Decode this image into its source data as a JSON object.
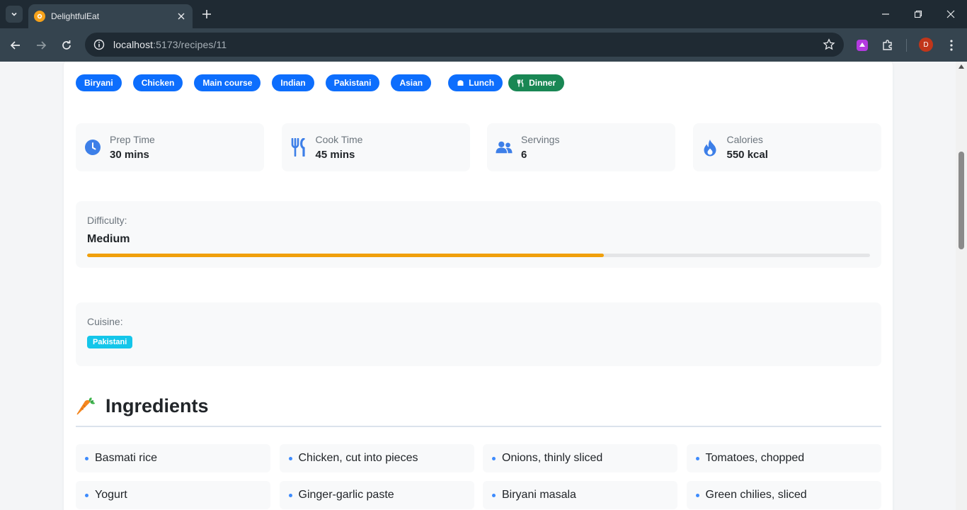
{
  "browser": {
    "tab_title": "DelightfulEat",
    "url_host": "localhost",
    "url_rest": ":5173/recipes/11",
    "profile_initial": "D"
  },
  "tags": [
    {
      "label": "Biryani"
    },
    {
      "label": "Chicken"
    },
    {
      "label": "Main course"
    },
    {
      "label": "Indian"
    },
    {
      "label": "Pakistani"
    },
    {
      "label": "Asian"
    }
  ],
  "meals": [
    {
      "label": "Lunch",
      "icon": "hat-icon",
      "color": "#0d6efd"
    },
    {
      "label": "Dinner",
      "icon": "utensils-icon",
      "color": "#198754"
    }
  ],
  "stats": [
    {
      "label": "Prep Time",
      "value": "30 mins",
      "icon": "clock-icon"
    },
    {
      "label": "Cook Time",
      "value": "45 mins",
      "icon": "utensils-icon"
    },
    {
      "label": "Servings",
      "value": "6",
      "icon": "users-icon"
    },
    {
      "label": "Calories",
      "value": "550 kcal",
      "icon": "flame-icon"
    }
  ],
  "difficulty": {
    "label": "Difficulty:",
    "value": "Medium",
    "progress_percent": 66,
    "bar_color": "#f0a00c"
  },
  "cuisine": {
    "label": "Cuisine:",
    "value": "Pakistani",
    "badge_color": "#14c6ea"
  },
  "ingredients_section": {
    "title": "Ingredients",
    "icon": "carrot-icon"
  },
  "ingredients": [
    "Basmati rice",
    "Chicken, cut into pieces",
    "Onions, thinly sliced",
    "Tomatoes, chopped",
    "Yogurt",
    "Ginger-garlic paste",
    "Biryani masala",
    "Green chilies, sliced"
  ],
  "colors": {
    "primary": "#0d6efd",
    "success": "#198754",
    "accent_icon": "#3d7fe8"
  }
}
